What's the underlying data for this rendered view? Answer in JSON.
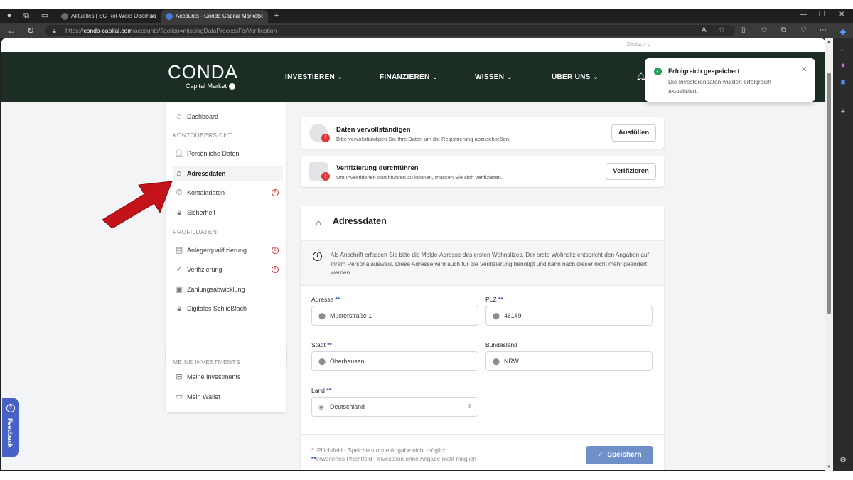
{
  "browser": {
    "tabs": [
      {
        "label": "Aktuelles | SC Rot-Weiß Oberhau"
      },
      {
        "label": "Accounts - Conda Capital Market"
      }
    ],
    "url_prefix": "https://",
    "url_host": "conda-capital.com",
    "url_path": "/accounts/?action=missingDataProcessForVerification"
  },
  "site": {
    "language": "Deutsch",
    "logo": "CONDA",
    "logo_sub": "Capital Market",
    "nav": [
      "INVESTIEREN",
      "FINANZIEREN",
      "WISSEN",
      "ÜBER UNS"
    ],
    "brand_color": "#1c2e24"
  },
  "sidebar": {
    "dashboard": "Dashboard",
    "section_account": "KONTOÜBERSICHT",
    "account_items": [
      {
        "label": "Persönliche Daten",
        "icon": "user-icon",
        "warning": false
      },
      {
        "label": "Adressdaten",
        "icon": "home-icon",
        "warning": false,
        "active": true
      },
      {
        "label": "Kontaktdaten",
        "icon": "phone-icon",
        "warning": true
      },
      {
        "label": "Sicherheit",
        "icon": "lock-icon",
        "warning": false
      }
    ],
    "section_profile": "PROFILDATEN",
    "profile_items": [
      {
        "label": "Anlegerqualifizierung",
        "icon": "document-icon",
        "warning": true
      },
      {
        "label": "Verifizierung",
        "icon": "check-circle-icon",
        "warning": true
      },
      {
        "label": "Zahlungsabwicklung",
        "icon": "payment-icon",
        "warning": false
      },
      {
        "label": "Digitales Schließfach",
        "icon": "lock-icon",
        "warning": false
      }
    ],
    "section_investments": "MEINE INVESTMENTS",
    "investment_items": [
      {
        "label": "Meine Investments",
        "icon": "bag-icon"
      },
      {
        "label": "Mein Wallet",
        "icon": "wallet-icon"
      }
    ]
  },
  "tasks": [
    {
      "title": "Daten vervollständigen",
      "subtitle": "Bitte vervollständigen Sie Ihre Daten um die Registrierung abzuschließen.",
      "button": "Ausfüllen"
    },
    {
      "title": "Verifizierung durchführen",
      "subtitle": "Um Investitionen durchführen zu können, müssen Sie sich verifizieren.",
      "button": "Verifizieren"
    }
  ],
  "form": {
    "title": "Adressdaten",
    "info": "Als Anschrift erfassen Sie bitte die Melde-Adresse des ersten Wohnsitzes. Der erste Wohnsitz entspricht den Angaben auf Ihrem Personalausweis. Diese Adresse wird auch für die Verifizierung benötigt und kann nach dieser nicht mehr geändert werden.",
    "fields": {
      "adresse": {
        "label": "Adresse",
        "req": "**",
        "value": "Musterstraße 1"
      },
      "plz": {
        "label": "PLZ",
        "req": "**",
        "value": "46149"
      },
      "stadt": {
        "label": "Stadt",
        "req": "**",
        "value": "Oberhausen"
      },
      "bundesland": {
        "label": "Bundesland",
        "req": "",
        "value": "NRW"
      },
      "land": {
        "label": "Land",
        "req": "**",
        "value": "Deutschland"
      }
    },
    "note_required_mark": "*",
    "note_required": "Pflichtfeld - Speichern ohne Angabe nicht möglich",
    "note_extended_mark": "**",
    "note_extended": "erweitertes Pflichtfeld - Investition ohne Angabe nicht möglich",
    "save": "Speichern"
  },
  "toast": {
    "title": "Erfolgreich gespeichert",
    "message": "Die Investorendaten wurden erfolgreich aktualisiert."
  },
  "feedback": "Feedback"
}
